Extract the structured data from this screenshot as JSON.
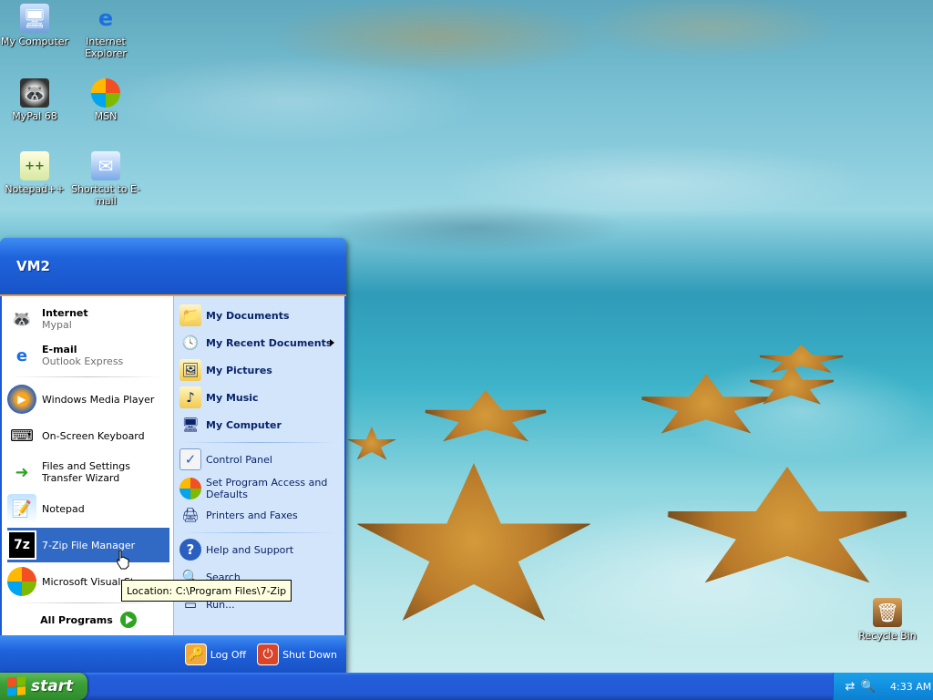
{
  "desktop": {
    "icons": [
      {
        "label": "My Computer",
        "icon": "computer-icon"
      },
      {
        "label": "Internet Explorer",
        "icon": "internet-explorer-icon"
      },
      {
        "label": "MyPal 68",
        "icon": "mypal-icon"
      },
      {
        "label": "MSN",
        "icon": "msn-icon"
      },
      {
        "label": "Notepad++",
        "icon": "notepadpp-icon"
      },
      {
        "label": "Shortcut to E-mail",
        "icon": "email-shortcut-icon"
      },
      {
        "label": "Recycle Bin",
        "icon": "recycle-bin-icon"
      }
    ]
  },
  "start_menu": {
    "user": "VM2",
    "pinned": [
      {
        "main": "Internet",
        "sub": "Mypal",
        "icon": "mypal-icon"
      },
      {
        "main": "E-mail",
        "sub": "Outlook Express",
        "icon": "outlook-express-icon"
      }
    ],
    "recent": [
      {
        "label": "Windows Media Player",
        "icon": "media-player-icon"
      },
      {
        "label": "On-Screen Keyboard",
        "icon": "keyboard-icon"
      },
      {
        "label": "Files and Settings Transfer Wizard",
        "icon": "transfer-wizard-icon"
      },
      {
        "label": "Notepad",
        "icon": "notepad-icon"
      },
      {
        "label": "7-Zip File Manager",
        "icon": "7zip-icon"
      },
      {
        "label": "Microsoft Visual St",
        "icon": "visual-studio-icon"
      }
    ],
    "all_programs": "All Programs",
    "right_primary": [
      {
        "label": "My Documents",
        "icon": "folder-icon"
      },
      {
        "label": "My Recent Documents",
        "icon": "recent-docs-icon"
      },
      {
        "label": "My Pictures",
        "icon": "pictures-icon"
      },
      {
        "label": "My Music",
        "icon": "music-icon"
      },
      {
        "label": "My Computer",
        "icon": "computer-icon"
      }
    ],
    "right_secondary": [
      {
        "label": "Control Panel",
        "icon": "control-panel-icon"
      },
      {
        "label": "Set Program Access and Defaults",
        "icon": "program-defaults-icon"
      },
      {
        "label": "Printers and Faxes",
        "icon": "printer-icon"
      }
    ],
    "right_tertiary": [
      {
        "label": "Help and Support",
        "icon": "help-icon"
      },
      {
        "label": "Search",
        "icon": "search-icon"
      },
      {
        "label": "Run...",
        "icon": "run-icon"
      }
    ],
    "log_off": "Log Off",
    "shut_down": "Shut Down"
  },
  "tooltip": "Location: C:\\Program Files\\7-Zip",
  "taskbar": {
    "start_label": "start",
    "clock": "4:33 AM"
  }
}
